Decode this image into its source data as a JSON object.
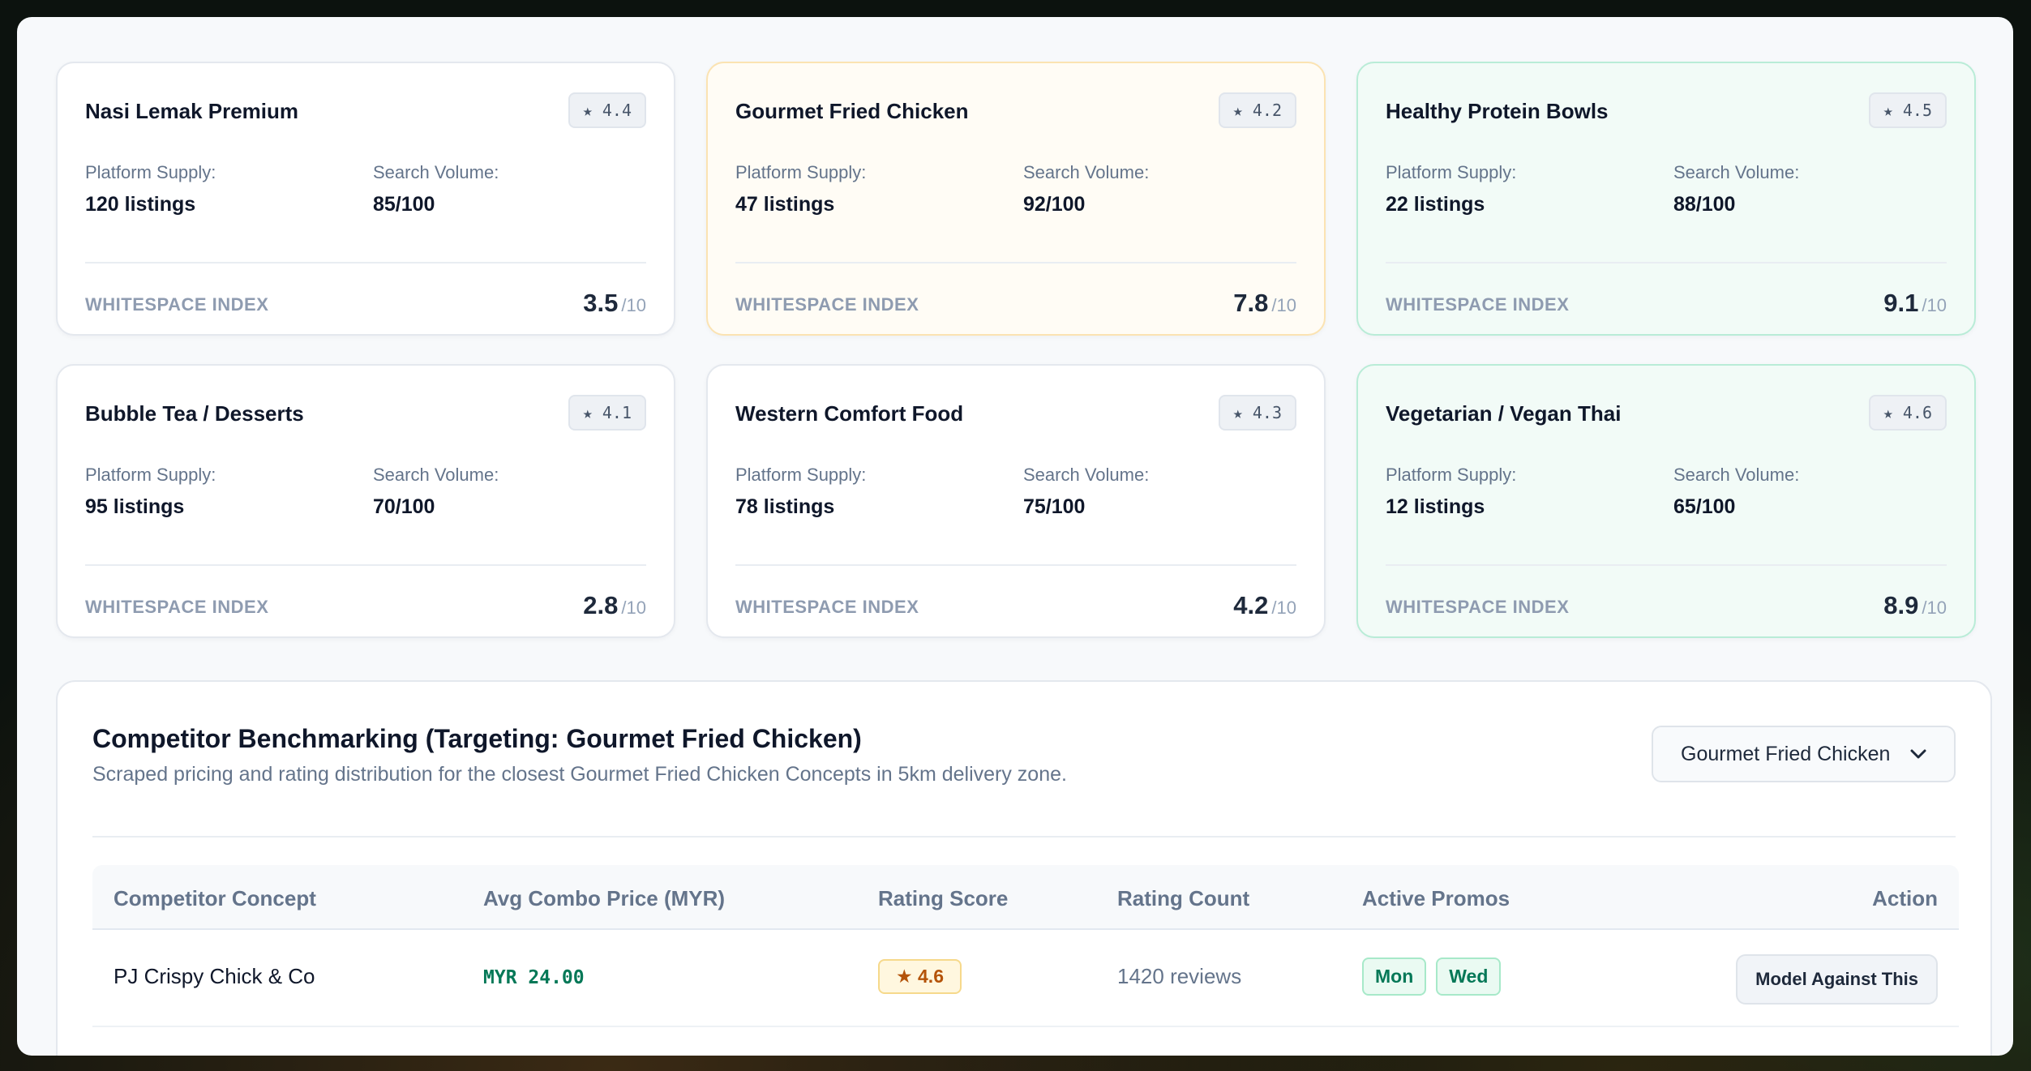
{
  "cards": [
    {
      "title": "Nasi Lemak Premium",
      "rating": "★ 4.4",
      "supply_label": "Platform Supply:",
      "supply": "120 listings",
      "search_label": "Search Volume:",
      "search": "85/100",
      "index_label": "WHITESPACE INDEX",
      "index": "3.5",
      "index_den": "/10"
    },
    {
      "title": "Gourmet Fried Chicken",
      "rating": "★ 4.2",
      "supply_label": "Platform Supply:",
      "supply": "47 listings",
      "search_label": "Search Volume:",
      "search": "92/100",
      "index_label": "WHITESPACE INDEX",
      "index": "7.8",
      "index_den": "/10"
    },
    {
      "title": "Healthy Protein Bowls",
      "rating": "★ 4.5",
      "supply_label": "Platform Supply:",
      "supply": "22 listings",
      "search_label": "Search Volume:",
      "search": "88/100",
      "index_label": "WHITESPACE INDEX",
      "index": "9.1",
      "index_den": "/10"
    },
    {
      "title": "Bubble Tea / Desserts",
      "rating": "★ 4.1",
      "supply_label": "Platform Supply:",
      "supply": "95 listings",
      "search_label": "Search Volume:",
      "search": "70/100",
      "index_label": "WHITESPACE INDEX",
      "index": "2.8",
      "index_den": "/10"
    },
    {
      "title": "Western Comfort Food",
      "rating": "★ 4.3",
      "supply_label": "Platform Supply:",
      "supply": "78 listings",
      "search_label": "Search Volume:",
      "search": "75/100",
      "index_label": "WHITESPACE INDEX",
      "index": "4.2",
      "index_den": "/10"
    },
    {
      "title": "Vegetarian / Vegan Thai",
      "rating": "★ 4.6",
      "supply_label": "Platform Supply:",
      "supply": "12 listings",
      "search_label": "Search Volume:",
      "search": "65/100",
      "index_label": "WHITESPACE INDEX",
      "index": "8.9",
      "index_den": "/10"
    }
  ],
  "benchmark": {
    "title": "Competitor Benchmarking (Targeting: Gourmet Fried Chicken)",
    "subtitle": "Scraped pricing and rating distribution for the closest Gourmet Fried Chicken Concepts in 5km delivery zone.",
    "select_value": "Gourmet Fried Chicken",
    "columns": [
      "Competitor Concept",
      "Avg Combo Price (MYR)",
      "Rating Score",
      "Rating Count",
      "Active Promos",
      "Action"
    ],
    "rows": [
      {
        "name": "PJ Crispy Chick & Co",
        "price": "MYR 24.00",
        "rating": "★ 4.6",
        "count": "1420 reviews",
        "promos": [
          "Mon",
          "Wed"
        ],
        "action": "Model Against This"
      }
    ]
  },
  "colors": {
    "accent_green": "#047857",
    "warn_border": "#fbe3b2",
    "good_border": "#b9ecd7"
  }
}
